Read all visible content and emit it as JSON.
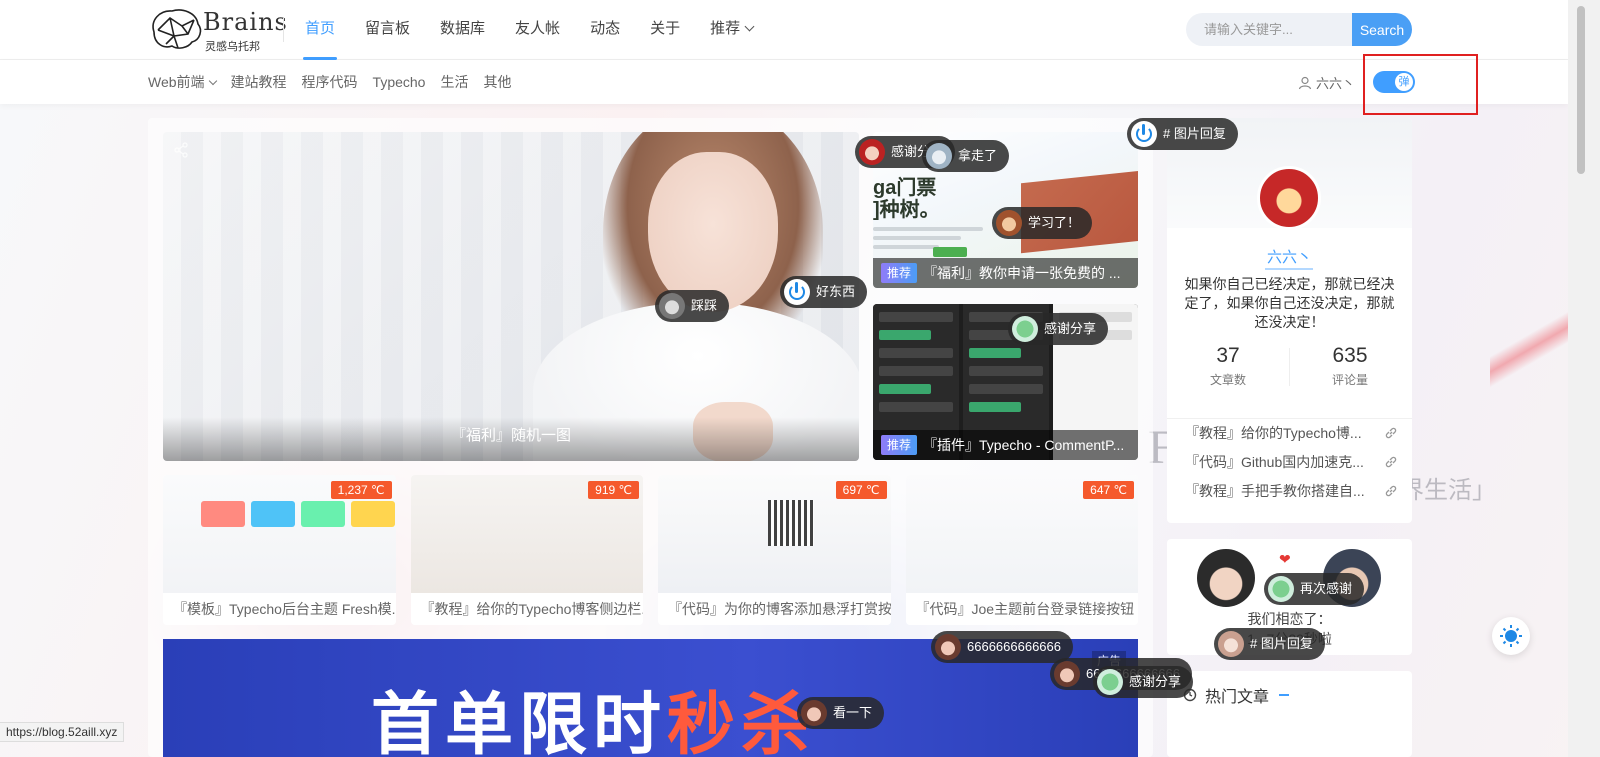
{
  "header": {
    "logo_brand": "Brains",
    "logo_sub": "灵感乌托邦",
    "nav": [
      {
        "label": "首页",
        "active": true
      },
      {
        "label": "留言板"
      },
      {
        "label": "数据库"
      },
      {
        "label": "友人帐"
      },
      {
        "label": "动态"
      },
      {
        "label": "关于"
      },
      {
        "label": "推荐",
        "has_dropdown": true
      }
    ],
    "search": {
      "placeholder": "请输入关键字...",
      "button_label": "Search"
    }
  },
  "subheader": {
    "categories": [
      {
        "label": "Web前端",
        "has_dropdown": true
      },
      {
        "label": "建站教程"
      },
      {
        "label": "程序代码"
      },
      {
        "label": "Typecho"
      },
      {
        "label": "生活"
      },
      {
        "label": "其他"
      }
    ],
    "user_label": "六六丶",
    "toggle_label": "弹"
  },
  "hero": {
    "caption": "『福利』随机一图"
  },
  "side_cards": [
    {
      "tag": "推荐",
      "title": "『福利』教你申请一张免费的 ...",
      "art_text": "ga门票\n]种树。"
    },
    {
      "tag": "推荐",
      "title": "『插件』Typecho - CommentP..."
    }
  ],
  "thumbs": [
    {
      "heat": "1,237 ℃",
      "title": "『模板』Typecho后台主题 Fresh模..."
    },
    {
      "heat": "919 ℃",
      "title": "『教程』给你的Typecho博客侧边栏..."
    },
    {
      "heat": "697 ℃",
      "title": "『代码』为你的博客添加悬浮打赏按..."
    },
    {
      "heat": "647 ℃",
      "title": "『代码』Joe主题前台登录链接按钮"
    }
  ],
  "banner": {
    "text_main": "首单限时",
    "text_hot": "秒杀",
    "ad_label": "广告"
  },
  "profile": {
    "name": "六六丶",
    "motto": "如果你自己已经决定，那就已经决定了，如果你自己还没决定，那就还没决定！",
    "stats": [
      {
        "value": "37",
        "label": "文章数"
      },
      {
        "value": "635",
        "label": "评论量"
      }
    ],
    "links": [
      "『教程』给你的Typecho博...",
      "『代码』Github国内加速克...",
      "『教程』手把手教你搭建自..."
    ]
  },
  "love": {
    "text": "我们相恋了：",
    "timer": "1...7分29秒啦"
  },
  "hot": {
    "title": "热门文章"
  },
  "bg_text": {
    "left": "Fre",
    "right": "界生活」"
  },
  "bullets": [
    {
      "text": "感谢分享",
      "avatar": "a1"
    },
    {
      "text": "拿走了",
      "avatar": "a2"
    },
    {
      "text": "# 图片回复",
      "avatar": "power"
    },
    {
      "text": "学习了！",
      "avatar": "a3"
    },
    {
      "text": "好东西",
      "avatar": "power"
    },
    {
      "text": "踩踩",
      "avatar": "a5"
    },
    {
      "text": "感谢分享",
      "avatar": "a4"
    },
    {
      "text": "再次感谢",
      "avatar": "a4"
    },
    {
      "text": "# 图片回复",
      "avatar": "a7"
    },
    {
      "text": "6666666666666",
      "avatar": "a6"
    },
    {
      "text": "6666666666666",
      "avatar": "a6"
    },
    {
      "text": "感谢分享",
      "avatar": "a4"
    },
    {
      "text": "看一下",
      "avatar": "a6"
    }
  ],
  "status_url": "https://blog.52aill.xyz",
  "colors": {
    "accent": "#409eff",
    "heat": "#f5592c",
    "highlight": "#e02020"
  }
}
